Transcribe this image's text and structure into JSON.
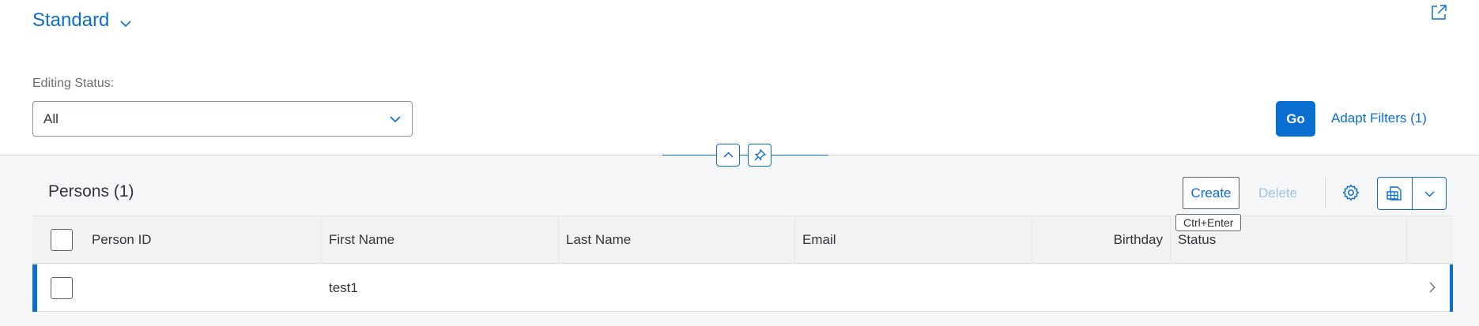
{
  "variant": {
    "title": "Standard",
    "chevron_icon": "chevron-down-icon"
  },
  "share_icon": "share-icon",
  "filters": {
    "editing_status_label": "Editing Status:",
    "editing_status_value": "All"
  },
  "go_label": "Go",
  "adapt_filters_label": "Adapt Filters (1)",
  "table": {
    "title": "Persons (1)",
    "toolbar": {
      "create_label": "Create",
      "delete_label": "Delete",
      "create_tooltip": "Ctrl+Enter",
      "settings_icon": "gear-icon",
      "export_icon": "export-spreadsheet-icon"
    },
    "columns": [
      "Person ID",
      "First Name",
      "Last Name",
      "Email",
      "Birthday",
      "Status"
    ],
    "rows": [
      {
        "person_id": "",
        "first_name": "test1",
        "last_name": "",
        "email": "",
        "birthday": "",
        "status": ""
      }
    ]
  },
  "colors": {
    "accent": "#0a6ed1",
    "text": "#32363a",
    "disabled": "#9fc5ea"
  }
}
